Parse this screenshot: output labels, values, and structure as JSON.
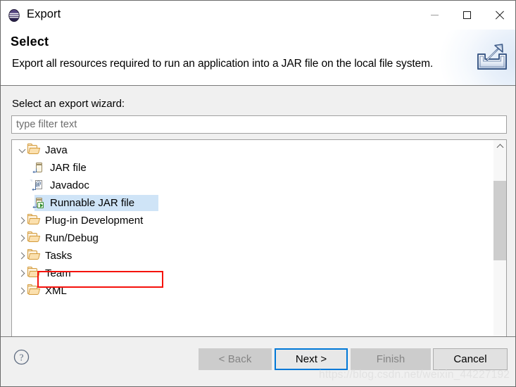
{
  "window": {
    "title": "Export",
    "app_icon": "eclipse-icon",
    "controls": {
      "minimize": "minimize-icon",
      "maximize": "maximize-icon",
      "close": "close-icon"
    }
  },
  "header": {
    "title": "Select",
    "description": "Export all resources required to run an application into a JAR file on the local file system.",
    "banner_icon": "export-icon"
  },
  "main": {
    "section_label": "Select an export wizard:",
    "filter": {
      "value": "",
      "placeholder": "type filter text"
    },
    "tree": [
      {
        "label": "Java",
        "icon": "folder-icon",
        "level": 0,
        "state": "expanded",
        "selected": false
      },
      {
        "label": "JAR file",
        "icon": "jar-file-icon",
        "level": 1,
        "state": "leaf",
        "selected": false
      },
      {
        "label": "Javadoc",
        "icon": "javadoc-icon",
        "level": 1,
        "state": "leaf",
        "selected": false
      },
      {
        "label": "Runnable JAR file",
        "icon": "runnable-jar-file-icon",
        "level": 1,
        "state": "leaf",
        "selected": true
      },
      {
        "label": "Plug-in Development",
        "icon": "folder-icon",
        "level": 0,
        "state": "collapsed",
        "selected": false
      },
      {
        "label": "Run/Debug",
        "icon": "folder-icon",
        "level": 0,
        "state": "collapsed",
        "selected": false
      },
      {
        "label": "Tasks",
        "icon": "folder-icon",
        "level": 0,
        "state": "collapsed",
        "selected": false
      },
      {
        "label": "Team",
        "icon": "folder-icon",
        "level": 0,
        "state": "collapsed",
        "selected": false
      },
      {
        "label": "XML",
        "icon": "folder-icon",
        "level": 0,
        "state": "collapsed",
        "selected": false
      }
    ],
    "scrollbar": {
      "up_arrow": "chevron-up-icon",
      "down_arrow": "chevron-down-icon"
    },
    "annotation": {
      "color": "#f5120c",
      "target": "Runnable JAR file"
    }
  },
  "footer": {
    "help_icon": "help-icon",
    "buttons": [
      {
        "label": "< Back",
        "state": "disabled"
      },
      {
        "label": "Next >",
        "state": "default"
      },
      {
        "label": "Finish",
        "state": "disabled"
      },
      {
        "label": "Cancel",
        "state": "normal"
      }
    ]
  },
  "watermark": {
    "text": "https://blog.csdn.net/weixin_44227192"
  }
}
